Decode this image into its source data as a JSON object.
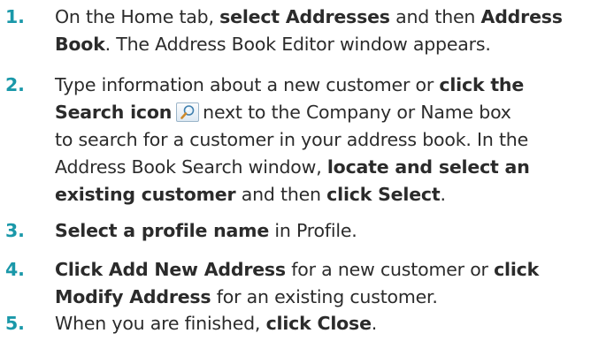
{
  "steps": [
    {
      "number": "1.",
      "lines": [
        [
          {
            "t": "On the Home tab, "
          },
          {
            "t": "select Addresses",
            "b": true
          },
          {
            "t": " and then "
          },
          {
            "t": "Address",
            "b": true
          }
        ],
        [
          {
            "t": "Book",
            "b": true
          },
          {
            "t": ". The Address Book Editor window appears."
          }
        ]
      ]
    },
    {
      "number": "2.",
      "lines": [
        [
          {
            "t": "Type information about a new customer or "
          },
          {
            "t": "click the",
            "b": true
          }
        ],
        [
          {
            "t": "Search icon",
            "b": true
          },
          {
            "icon": "search-icon"
          },
          {
            "t": "next to the Company or Name box"
          }
        ],
        [
          {
            "t": "to search for a customer in your address book. In the"
          }
        ],
        [
          {
            "t": "Address Book Search window, "
          },
          {
            "t": "locate and select an",
            "b": true
          }
        ],
        [
          {
            "t": "existing customer",
            "b": true
          },
          {
            "t": " and then "
          },
          {
            "t": "click Select",
            "b": true
          },
          {
            "t": "."
          }
        ]
      ]
    },
    {
      "number": "3.",
      "lines": [
        [
          {
            "t": "Select a profile name",
            "b": true
          },
          {
            "t": " in Profile."
          }
        ]
      ]
    },
    {
      "number": "4.",
      "lines": [
        [
          {
            "t": "Click Add New Address",
            "b": true
          },
          {
            "t": " for a new customer or "
          },
          {
            "t": "click",
            "b": true
          }
        ],
        [
          {
            "t": "Modify Address",
            "b": true
          },
          {
            "t": " for an existing customer."
          }
        ]
      ]
    },
    {
      "number": "5.",
      "lines": [
        [
          {
            "t": "When you are finished, "
          },
          {
            "t": "click Close",
            "b": true
          },
          {
            "t": "."
          }
        ]
      ]
    }
  ]
}
